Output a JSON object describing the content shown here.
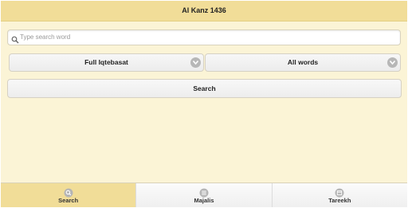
{
  "header": {
    "title": "Al Kanz 1436"
  },
  "search": {
    "placeholder": "Type search word",
    "value": ""
  },
  "selects": {
    "scope": {
      "selected": "Full Iqtebasat",
      "icon": "chevron-down-icon"
    },
    "match": {
      "selected": "All words",
      "icon": "chevron-down-icon"
    }
  },
  "actions": {
    "search_label": "Search"
  },
  "tabs": [
    {
      "label": "Search",
      "icon": "search-icon",
      "active": true
    },
    {
      "label": "Majalis",
      "icon": "list-icon",
      "active": false
    },
    {
      "label": "Tareekh",
      "icon": "calendar-icon",
      "active": false
    }
  ],
  "colors": {
    "header_bg": "#f1dd98",
    "page_bg": "#fbf4d6",
    "active_tab_bg": "#f1dd98"
  }
}
